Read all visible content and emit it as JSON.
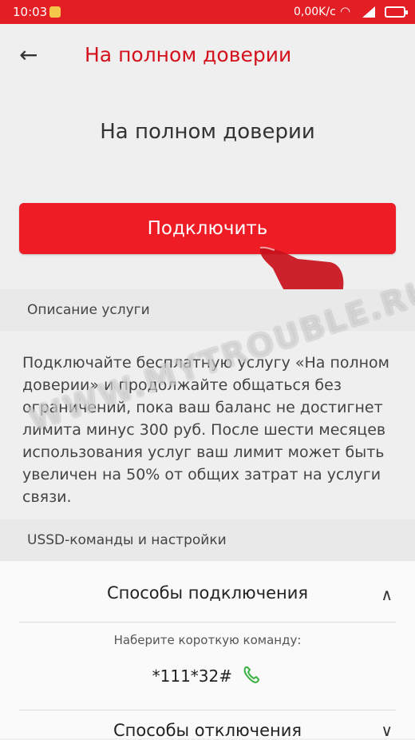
{
  "status_bar": {
    "time": "10:03",
    "network_speed": "0,00K/c"
  },
  "header": {
    "title": "На полном доверии",
    "back_icon": "arrow-left-icon"
  },
  "service": {
    "title": "На полном доверии",
    "connect_label": "Подключить"
  },
  "description": {
    "section_label": "Описание услуги",
    "text": "Подключайте бесплатную услугу «На полном доверии» и продолжайте общаться без ограничений, пока ваш баланс не достигнет лимита минус 300 руб. После шести месяцев использования услуг ваш лимит может быть увеличен на 50% от общих затрат на услуги связи."
  },
  "ussd": {
    "section_label": "USSD-команды и настройки",
    "connect_title": "Способы подключения",
    "hint": "Наберите короткую команду:",
    "command": "*111*32#",
    "disconnect_title": "Способы отключения"
  },
  "watermark": "WWW.MYTROUBLE.RU",
  "colors": {
    "accent": "#e41e25",
    "phone_green": "#3cb043"
  }
}
